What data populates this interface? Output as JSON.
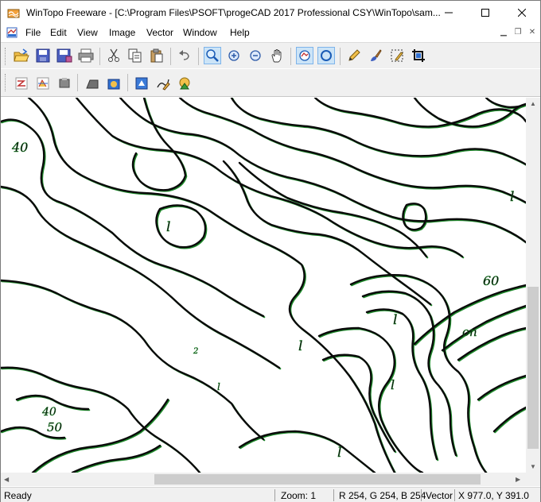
{
  "window": {
    "title": "WinTopo Freeware - [C:\\Program Files\\PSOFT\\progeCAD 2017 Professional CSY\\WinTopo\\sam...",
    "controls": {
      "minimize": "—",
      "maximize": "☐",
      "close": "✕"
    }
  },
  "menu": [
    "File",
    "Edit",
    "View",
    "Image",
    "Vector",
    "Window",
    "Help"
  ],
  "toolbar1": [
    "open-icon",
    "save-icon",
    "save-as-icon",
    "print-icon",
    "cut-icon",
    "copy-icon",
    "paste-icon",
    "undo-icon",
    "zoom-select-icon",
    "zoom-in-icon",
    "zoom-out-icon",
    "pan-hand-icon",
    "view-image-icon",
    "view-vector-icon",
    "pencil-icon",
    "brush-icon",
    "selection-icon",
    "crop-icon"
  ],
  "toolbar2": [
    "thin-icon",
    "threshold-icon",
    "grayscale-icon",
    "flatten-icon",
    "vectorize-icon",
    "one-touch-vectorize-icon",
    "edit-vectors-icon",
    "optimize-icon"
  ],
  "map_labels": [
    "40",
    "l",
    "l",
    "60",
    "l",
    "2",
    "l",
    "on",
    "l",
    "l",
    "40",
    "50",
    "l"
  ],
  "status": {
    "ready": "Ready",
    "zoom": "Zoom: 1",
    "rgb": "R 254, G 254, B 254",
    "mode": "Vector",
    "coords": "X 977.0, Y 391.0"
  }
}
